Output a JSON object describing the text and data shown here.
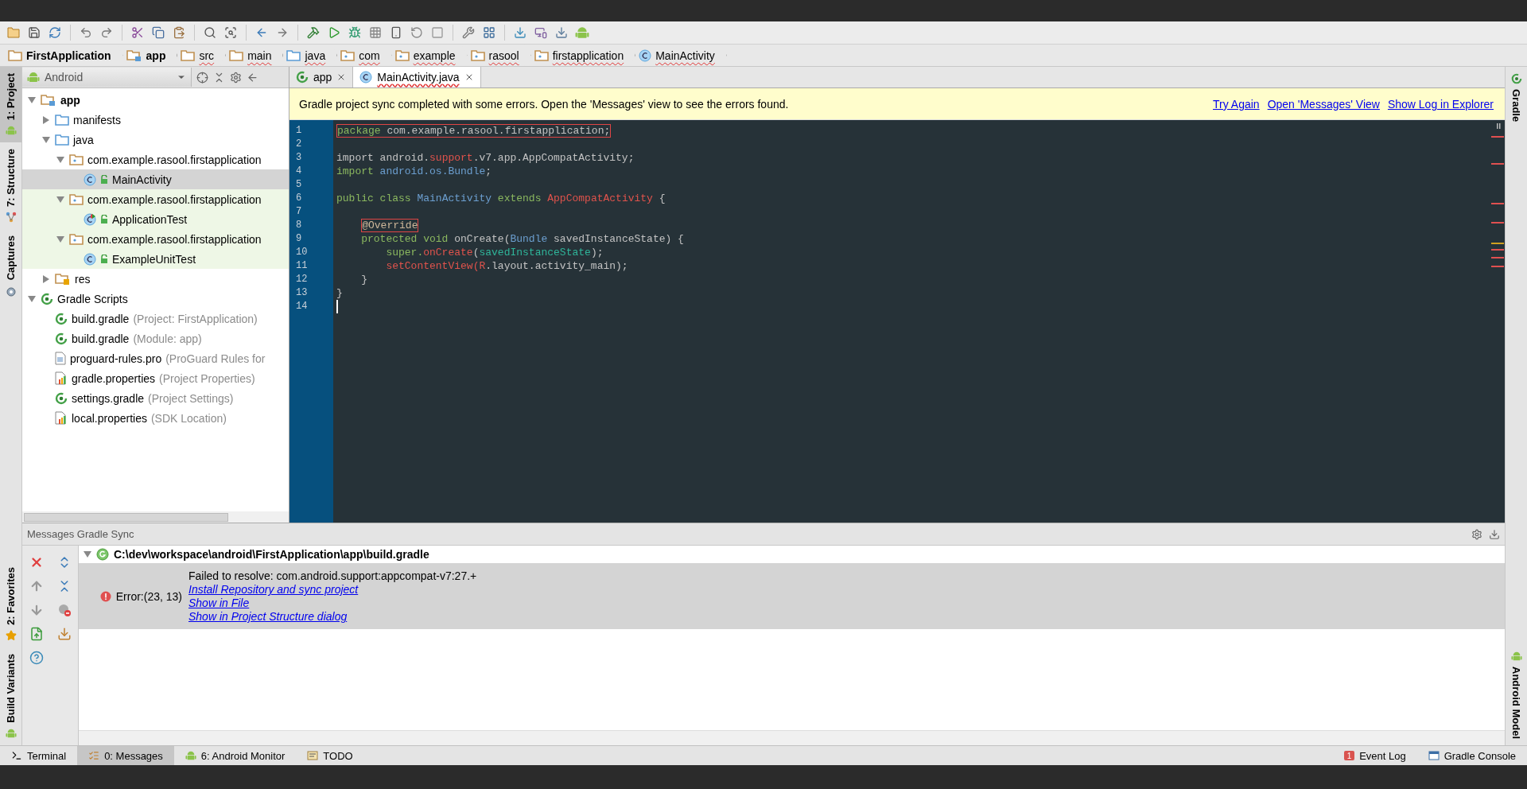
{
  "breadcrumbs": [
    {
      "label": "FirstApplication",
      "kind": "project",
      "error": false
    },
    {
      "label": "app",
      "kind": "module",
      "error": false
    },
    {
      "label": "src",
      "kind": "folder",
      "error": true
    },
    {
      "label": "main",
      "kind": "folder",
      "error": true
    },
    {
      "label": "java",
      "kind": "source",
      "error": true
    },
    {
      "label": "com",
      "kind": "package",
      "error": true
    },
    {
      "label": "example",
      "kind": "package",
      "error": true
    },
    {
      "label": "rasool",
      "kind": "package",
      "error": true
    },
    {
      "label": "firstapplication",
      "kind": "package",
      "error": true
    },
    {
      "label": "MainActivity",
      "kind": "class",
      "error": true
    }
  ],
  "left_strip": {
    "top": [
      {
        "label": "1: Project",
        "kind": "project",
        "selected": true
      },
      {
        "label": "7: Structure",
        "kind": "structure",
        "selected": false
      },
      {
        "label": "Captures",
        "kind": "captures",
        "selected": false
      }
    ],
    "bottom": [
      {
        "label": "2: Favorites",
        "kind": "favorites",
        "selected": false
      },
      {
        "label": "Build Variants",
        "kind": "android",
        "selected": false
      }
    ]
  },
  "right_strip": {
    "top": [
      {
        "label": "Gradle",
        "kind": "gradle"
      }
    ],
    "bottom": [
      {
        "label": "Android Model",
        "kind": "android"
      }
    ]
  },
  "project": {
    "view": "Android",
    "tree": [
      {
        "label": "app",
        "kind": "module",
        "expanded": true,
        "selected": false,
        "test": false,
        "children": [
          {
            "label": "manifests",
            "kind": "source",
            "expanded": false,
            "selected": false,
            "test": false
          },
          {
            "label": "java",
            "kind": "source",
            "expanded": true,
            "selected": false,
            "test": false,
            "children": [
              {
                "label": "com.example.rasool.firstapplication",
                "kind": "package",
                "expanded": true,
                "selected": false,
                "test": false,
                "children": [
                  {
                    "label": "MainActivity",
                    "kind": "class",
                    "selected": true,
                    "test": false
                  }
                ]
              },
              {
                "label": "com.example.rasool.firstapplication",
                "kind": "package",
                "expanded": true,
                "selected": false,
                "test": true,
                "children": [
                  {
                    "label": "ApplicationTest",
                    "kind": "testclass",
                    "selected": false,
                    "test": true
                  }
                ]
              },
              {
                "label": "com.example.rasool.firstapplication",
                "kind": "package",
                "expanded": true,
                "selected": false,
                "test": true,
                "children": [
                  {
                    "label": "ExampleUnitTest",
                    "kind": "class",
                    "selected": false,
                    "test": true
                  }
                ]
              }
            ]
          },
          {
            "label": "res",
            "kind": "res",
            "expanded": false,
            "selected": false,
            "test": false
          }
        ]
      },
      {
        "label": "Gradle Scripts",
        "kind": "gradle",
        "expanded": true,
        "selected": false,
        "test": false,
        "children": [
          {
            "label": "build.gradle",
            "note": "(Project: FirstApplication)",
            "kind": "gradle",
            "selected": false,
            "test": false
          },
          {
            "label": "build.gradle",
            "note": "(Module: app)",
            "kind": "gradle",
            "selected": false,
            "test": false
          },
          {
            "label": "proguard-rules.pro",
            "note": "(ProGuard Rules for",
            "kind": "file",
            "selected": false,
            "test": false
          },
          {
            "label": "gradle.properties",
            "note": "(Project Properties)",
            "kind": "properties",
            "selected": false,
            "test": false
          },
          {
            "label": "settings.gradle",
            "note": "(Project Settings)",
            "kind": "gradle",
            "selected": false,
            "test": false
          },
          {
            "label": "local.properties",
            "note": "(SDK Location)",
            "kind": "properties",
            "selected": false,
            "test": false
          }
        ]
      }
    ]
  },
  "editor_tabs": [
    {
      "label": "app",
      "kind": "gradle",
      "selected": false,
      "error": false
    },
    {
      "label": "MainActivity.java",
      "kind": "class",
      "selected": true,
      "error": true
    }
  ],
  "notification": {
    "text": "Gradle project sync completed with some errors. Open the 'Messages' view to see the errors found.",
    "links": [
      "Try Again",
      "Open 'Messages' View",
      "Show Log in Explorer"
    ]
  },
  "code": [
    {
      "number": "1",
      "tokens": [
        {
          "text": "package",
          "kind": "keyword",
          "boxed": true
        },
        {
          "text": " com.example.rasool.firstapplication;",
          "kind": "plain",
          "boxed": true
        }
      ]
    },
    {
      "number": "2"
    },
    {
      "number": "3",
      "tokens": [
        {
          "text": "import android.",
          "kind": "plain",
          "boxed": false
        },
        {
          "text": "support",
          "kind": "error",
          "boxed": false
        },
        {
          "text": ".v7.app.AppCompatActivity;",
          "kind": "plain",
          "boxed": false
        }
      ]
    },
    {
      "number": "4",
      "tokens": [
        {
          "text": "import",
          "kind": "keyword",
          "boxed": false
        },
        {
          "text": " android.os.Bundle",
          "kind": "type",
          "boxed": false
        },
        {
          "text": ";",
          "kind": "plain",
          "boxed": false
        }
      ]
    },
    {
      "number": "5"
    },
    {
      "number": "6",
      "tokens": [
        {
          "text": "public class",
          "kind": "keyword",
          "boxed": false
        },
        {
          "text": " MainActivity",
          "kind": "type",
          "boxed": false
        },
        {
          "text": " extends",
          "kind": "keyword",
          "boxed": false
        },
        {
          "text": " AppCompatActivity",
          "kind": "error",
          "boxed": false
        },
        {
          "text": " {",
          "kind": "plain",
          "boxed": false
        }
      ]
    },
    {
      "number": "7"
    },
    {
      "number": "8",
      "tokens": [
        {
          "text": "    @Override",
          "kind": "annotation",
          "boxed": true
        }
      ]
    },
    {
      "number": "9",
      "tokens": [
        {
          "text": "    protected void",
          "kind": "keyword",
          "boxed": false
        },
        {
          "text": " onCreate(",
          "kind": "plain",
          "boxed": false
        },
        {
          "text": "Bundle",
          "kind": "type",
          "boxed": false
        },
        {
          "text": " savedInstanceState) {",
          "kind": "plain",
          "boxed": false
        }
      ]
    },
    {
      "number": "10",
      "tokens": [
        {
          "text": "        super.",
          "kind": "keyword",
          "boxed": false
        },
        {
          "text": "onCreate",
          "kind": "error",
          "boxed": false
        },
        {
          "text": "(",
          "kind": "plain",
          "boxed": false
        },
        {
          "text": "savedInstanceState",
          "kind": "param",
          "boxed": false
        },
        {
          "text": ");",
          "kind": "plain",
          "boxed": false
        }
      ]
    },
    {
      "number": "11",
      "tokens": [
        {
          "text": "        setContentView(R",
          "kind": "error",
          "boxed": false
        },
        {
          "text": ".layout.activity_main);",
          "kind": "plain",
          "boxed": false
        }
      ]
    },
    {
      "number": "12",
      "tokens": [
        {
          "text": "    }",
          "kind": "plain",
          "boxed": false
        }
      ]
    },
    {
      "number": "13",
      "tokens": [
        {
          "text": "}",
          "kind": "plain",
          "boxed": false
        }
      ]
    },
    {
      "number": "14",
      "caret": true
    }
  ],
  "messages": {
    "title": "Messages Gradle Sync",
    "file": "C:\\dev\\workspace\\android\\FirstApplication\\app\\build.gradle",
    "error": {
      "location": "Error:(23, 13)",
      "message": "Failed to resolve: com.android.support:appcompat-v7:27.+",
      "links": [
        "Install Repository and sync project",
        "Show in File",
        "Show in Project Structure dialog"
      ]
    }
  },
  "bottom_tabs": {
    "left": [
      {
        "label": "Terminal",
        "kind": "terminal",
        "selected": false
      },
      {
        "label": "0: Messages",
        "kind": "messages",
        "selected": true
      },
      {
        "label": "6: Android Monitor",
        "kind": "android",
        "selected": false
      },
      {
        "label": "TODO",
        "kind": "todo",
        "selected": false
      }
    ],
    "right": [
      {
        "label": "Event Log",
        "badge": "1",
        "kind": "eventlog",
        "selected": false
      },
      {
        "label": "Gradle Console",
        "kind": "console",
        "selected": false
      }
    ]
  }
}
